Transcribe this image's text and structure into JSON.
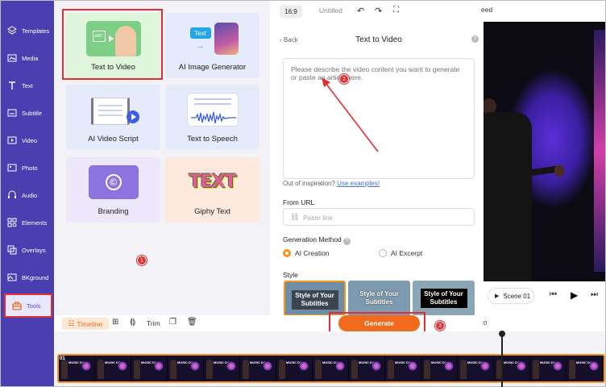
{
  "sidebar": {
    "items": [
      {
        "label": "Templates",
        "icon": "layers-icon"
      },
      {
        "label": "Media",
        "icon": "media-icon"
      },
      {
        "label": "Text",
        "icon": "text-icon"
      },
      {
        "label": "Subtitle",
        "icon": "subtitle-icon"
      },
      {
        "label": "Video",
        "icon": "video-icon"
      },
      {
        "label": "Photo",
        "icon": "photo-icon"
      },
      {
        "label": "Audio",
        "icon": "audio-icon"
      },
      {
        "label": "Elements",
        "icon": "elements-icon"
      },
      {
        "label": "Overlays",
        "icon": "overlays-icon"
      },
      {
        "label": "BKground",
        "icon": "background-icon"
      },
      {
        "label": "Tools",
        "icon": "toolbox-icon",
        "active": true
      }
    ]
  },
  "tools": {
    "cards": [
      {
        "label": "Text to Video",
        "color": "#dff5dc"
      },
      {
        "label": "AI Image Generator",
        "color": "#e5ebfb"
      },
      {
        "label": "AI Video Script",
        "color": "#e5ebfb"
      },
      {
        "label": "Text to Speech",
        "color": "#e5ebfb"
      },
      {
        "label": "Branding",
        "color": "#ece7fb"
      },
      {
        "label": "Giphy Text",
        "color": "#fde9de"
      }
    ],
    "art_text": {
      "abc": "ABC",
      "text_chip": "Text",
      "giphy": "TEXT"
    }
  },
  "badges": {
    "one": "1",
    "two": "2",
    "three": "3"
  },
  "topbar": {
    "ratio": "16:9",
    "title": "Untitled",
    "speed_fragment": "eed"
  },
  "form": {
    "back": "Back",
    "title": "Text to Video",
    "placeholder": "Please describe the video content you want to generate or paste an article here.",
    "inspiration": "Out of inspiration?",
    "examples_link": "Use examples!",
    "from_url": "From URL",
    "url_placeholder": "Paste link",
    "method_label": "Generation Method",
    "methods": [
      "AI Creation",
      "AI Excerpt"
    ],
    "style_label": "Style",
    "styles": [
      "Style of Your Subtitles",
      "Style of Your Subtitles",
      "Style of Your Subtitles"
    ],
    "generate": "Generate"
  },
  "preview": {
    "scene": "Scene 01"
  },
  "timeline": {
    "tab": "Timeline",
    "trim": "Trim",
    "time_fragment": ":0",
    "thumb_text": "MUSIC DAY",
    "first_marker": "01"
  },
  "colors": {
    "accent": "#f26a1b",
    "sidebar": "#4a3fb0",
    "annotation": "#e03030"
  }
}
